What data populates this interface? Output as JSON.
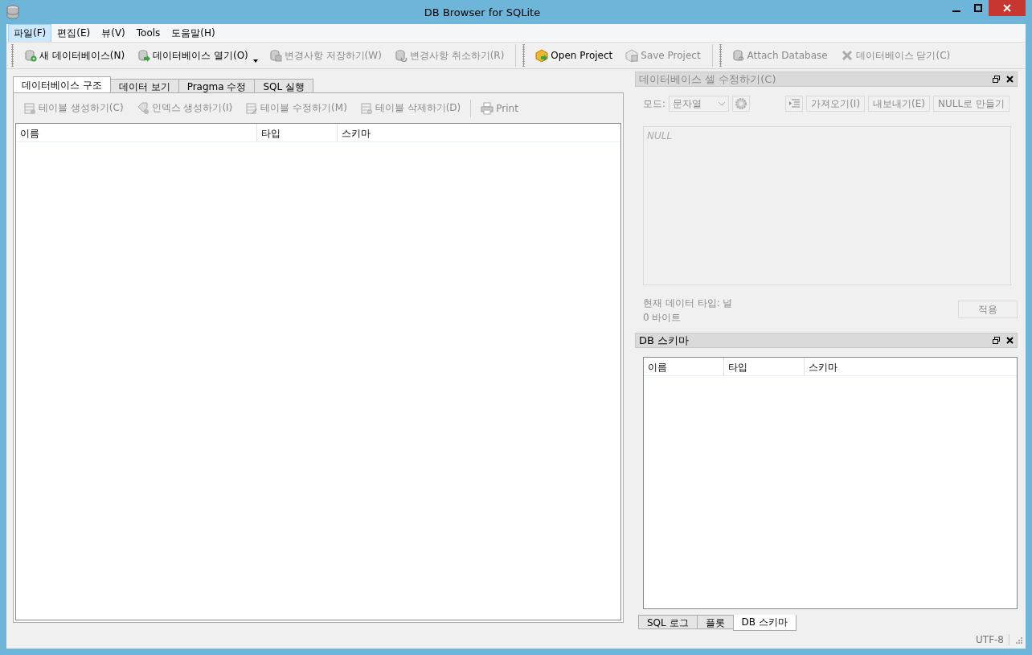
{
  "window": {
    "title": "DB Browser for SQLite"
  },
  "menu": [
    {
      "label": "파일(F)",
      "selected": true
    },
    {
      "label": "편집(E)",
      "selected": false
    },
    {
      "label": "뷰(V)",
      "selected": false
    },
    {
      "label": "Tools",
      "selected": false
    },
    {
      "label": "도움말(H)",
      "selected": false
    }
  ],
  "toolbar": [
    [
      {
        "kind": "new-db",
        "label": "새 데이터베이스(N)",
        "disabled": false,
        "dropdown": false
      },
      {
        "kind": "open-db",
        "label": "데이터베이스 열기(O)",
        "disabled": false,
        "dropdown": true
      },
      {
        "kind": "save-db",
        "label": "변경사항 저장하기(W)",
        "disabled": true,
        "dropdown": false
      },
      {
        "kind": "revert-db",
        "label": "변경사항 취소하기(R)",
        "disabled": true,
        "dropdown": false
      }
    ],
    [
      {
        "kind": "open-project",
        "label": "Open Project",
        "disabled": false,
        "dropdown": false
      },
      {
        "kind": "save-project",
        "label": "Save Project",
        "disabled": true,
        "dropdown": false
      }
    ],
    [
      {
        "kind": "attach-db",
        "label": "Attach Database",
        "disabled": true,
        "dropdown": false
      },
      {
        "kind": "close-db",
        "label": "데이터베이스 닫기(C)",
        "disabled": true,
        "dropdown": false
      }
    ]
  ],
  "tabs": [
    {
      "label": "데이터베이스 구조",
      "selected": true
    },
    {
      "label": "데이터 보기",
      "selected": false
    },
    {
      "label": "Pragma 수정",
      "selected": false
    },
    {
      "label": "SQL 실행",
      "selected": false
    }
  ],
  "structure_toolbar": [
    {
      "kind": "create-table",
      "label": "테이블 생성하기(C)",
      "disabled": true
    },
    {
      "kind": "create-index",
      "label": "인덱스 생성하기(I)",
      "disabled": true
    },
    {
      "kind": "modify-table",
      "label": "테이블 수정하기(M)",
      "disabled": true
    },
    {
      "kind": "delete-table",
      "label": "테이블 삭제하기(D)",
      "disabled": true
    },
    {
      "kind": "print",
      "label": "Print",
      "disabled": true
    }
  ],
  "structure_table": {
    "columns": [
      "이름",
      "타입",
      "스키마"
    ]
  },
  "edit_cell": {
    "title": "데이터베이스 셀 수정하기(C)",
    "disabled": true,
    "mode_label": "모드:",
    "mode_value": "문자열",
    "buttons": [
      "가져오기(I)",
      "내보내기(E)",
      "NULL로 만들기"
    ],
    "editor_placeholder": "NULL",
    "data_type": "현재 데이터 타입: 널",
    "size": "0 바이트",
    "apply": "적용"
  },
  "schema": {
    "title": "DB 스키마",
    "columns": [
      "이름",
      "타입",
      "스키마"
    ]
  },
  "dock_tabs": [
    {
      "label": "SQL 로그",
      "selected": false
    },
    {
      "label": "플롯",
      "selected": false
    },
    {
      "label": "DB 스키마",
      "selected": true
    }
  ],
  "status_bar": {
    "encoding": "UTF-8"
  }
}
